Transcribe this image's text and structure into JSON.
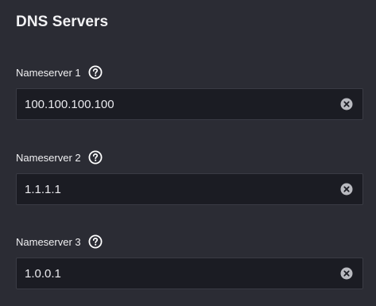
{
  "section": {
    "title": "DNS Servers"
  },
  "nameservers": [
    {
      "label": "Nameserver 1",
      "value": "100.100.100.100"
    },
    {
      "label": "Nameserver 2",
      "value": "1.1.1.1"
    },
    {
      "label": "Nameserver 3",
      "value": "1.0.0.1"
    }
  ],
  "icons": {
    "help": "question-circle-icon",
    "clear": "clear-circle-icon"
  },
  "colors": {
    "background": "#2b2c34",
    "input_background": "#1b1c23",
    "input_border": "#3a3b44",
    "text": "#ffffff",
    "clear_icon": "#b9bac0"
  }
}
